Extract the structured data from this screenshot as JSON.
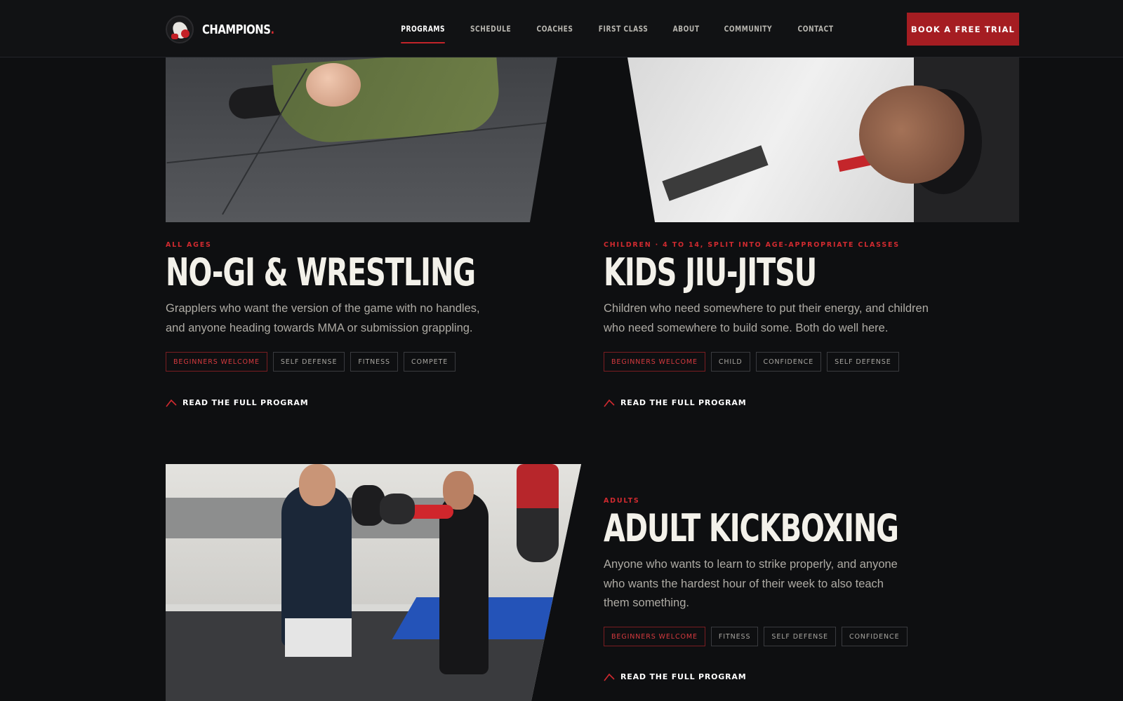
{
  "header": {
    "logo_text": "CHAMPIONS",
    "logo_dot": ".",
    "nav": [
      "PROGRAMS",
      "SCHEDULE",
      "COACHES",
      "FIRST CLASS",
      "ABOUT",
      "COMMUNITY",
      "CONTACT"
    ],
    "active_nav": "PROGRAMS",
    "cta_label": "BOOK A FREE TRIAL"
  },
  "colors": {
    "accent": "#c3242a",
    "background": "#0e0f11",
    "cta": "#a51d22"
  },
  "programs": [
    {
      "eyebrow": "ALL AGES",
      "title": "NO-GI & WRESTLING",
      "description": "Grapplers who want the version of the game with no handles, and anyone heading towards MMA or submission grappling.",
      "tags": [
        "BEGINNERS WELCOME",
        "SELF DEFENSE",
        "FITNESS",
        "COMPETE"
      ],
      "link": "READ THE FULL PROGRAM"
    },
    {
      "eyebrow": "CHILDREN · 4 TO 14, SPLIT INTO AGE-APPROPRIATE CLASSES",
      "title": "KIDS JIU-JITSU",
      "description": "Children who need somewhere to put their energy, and children who need somewhere to build some. Both do well here.",
      "tags": [
        "BEGINNERS WELCOME",
        "CHILD",
        "CONFIDENCE",
        "SELF DEFENSE"
      ],
      "link": "READ THE FULL PROGRAM"
    },
    {
      "eyebrow": "ADULTS",
      "title": "ADULT KICKBOXING",
      "description": "Anyone who wants to learn to strike properly, and anyone who wants the hardest hour of their week to also teach them something.",
      "tags": [
        "BEGINNERS WELCOME",
        "FITNESS",
        "SELF DEFENSE",
        "CONFIDENCE"
      ],
      "link": "READ THE FULL PROGRAM"
    }
  ]
}
